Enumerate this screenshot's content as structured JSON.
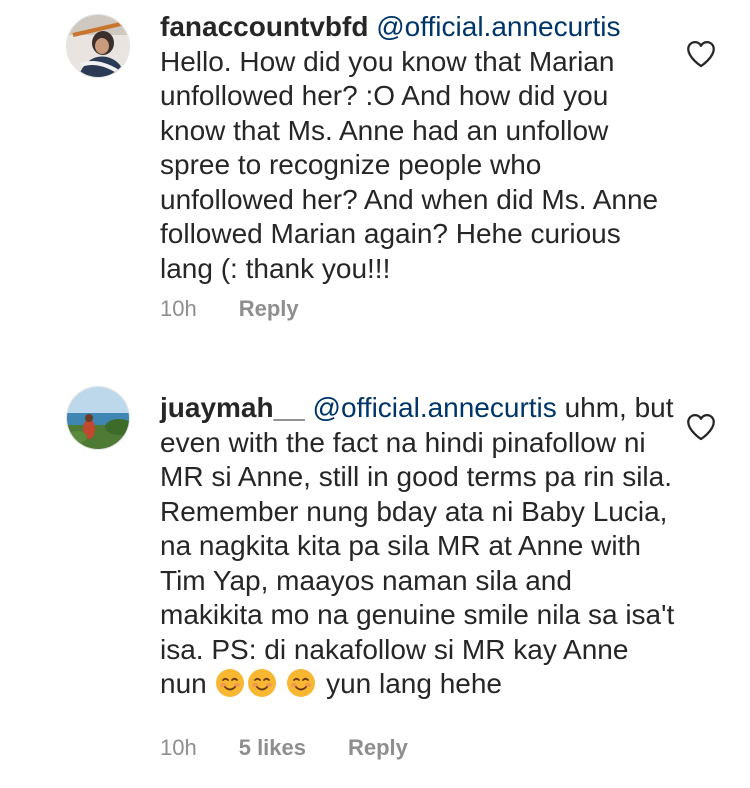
{
  "comments": [
    {
      "username": "fanaccountvbfd",
      "mention": "@official.annecurtis",
      "body": "Hello. How did you know that Marian unfollowed her? :O And how did you know that Ms. Anne had an unfollow spree to recognize people who unfollowed her? And when did Ms. Anne followed Marian again? Hehe curious lang (: thank you!!!",
      "time": "10h",
      "reply_label": "Reply"
    },
    {
      "username": "juaymah__",
      "mention": "@official.annecurtis",
      "body": "uhm, but even with the fact na hindi pinafollow ni MR si Anne, still in good terms pa rin sila. Remember nung bday ata ni Baby Lucia, na nagkita kita pa sila MR at Anne with Tim Yap, maayos naman sila and makikita mo na genuine smile nila sa isa't isa. PS: di nakafollow si MR kay Anne nun",
      "body_tail": "yun lang hehe",
      "time": "10h",
      "likes": "5 likes",
      "reply_label": "Reply"
    }
  ],
  "icons": {
    "heart": "heart-outline-icon",
    "emoji": "smiling-face-emoji"
  },
  "colors": {
    "text": "#262626",
    "mention": "#003569",
    "meta": "#8e8e8e",
    "heart_stroke": "#262626"
  }
}
